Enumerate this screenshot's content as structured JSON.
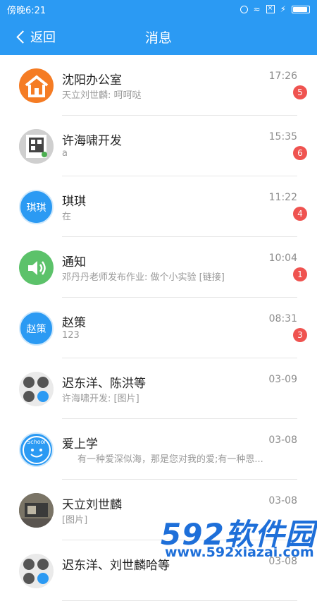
{
  "status_bar": {
    "time": "傍晚6:21"
  },
  "app_bar": {
    "back_label": "返回",
    "title": "消息"
  },
  "conversations": [
    {
      "name": "沈阳办公室",
      "preview": "天立刘世麟: 呵呵哒",
      "time": "17:26",
      "badge": "5",
      "avatar": "house-icon"
    },
    {
      "name": "许海啸开发",
      "preview": "a",
      "time": "15:35",
      "badge": "6",
      "avatar": "photo"
    },
    {
      "name": "琪琪",
      "preview": "在",
      "time": "11:22",
      "badge": "4",
      "avatar_text": "琪琪"
    },
    {
      "name": "通知",
      "preview": "邓丹丹老师发布作业: 做个小实验 [链接]",
      "time": "10:04",
      "badge": "1",
      "avatar": "speaker-icon"
    },
    {
      "name": "赵策",
      "preview": "123",
      "time": "08:31",
      "badge": "3",
      "avatar_text": "赵策"
    },
    {
      "name": "迟东洋、陈洪等",
      "preview": "许海啸开发: [图片]",
      "time": "03-09",
      "badge": null,
      "avatar": "group"
    },
    {
      "name": "爱上学",
      "preview": "有一种爱深似海，那是您对我的爱;有一种恩...",
      "time": "03-08",
      "badge": null,
      "avatar": "smiley-icon",
      "avatar_label": "School"
    },
    {
      "name": "天立刘世麟",
      "preview": "[图片]",
      "time": "03-08",
      "badge": null,
      "avatar": "photo"
    },
    {
      "name": "迟东洋、刘世麟哈等",
      "preview": "",
      "time": "03-08",
      "badge": null,
      "avatar": "group"
    }
  ],
  "watermark": {
    "big": "592软件园",
    "small": "www.592xiazai.com"
  },
  "colors": {
    "primary": "#2b9af3",
    "badge": "#ef5350",
    "house_avatar": "#f57c24",
    "notice_avatar": "#5cc26a"
  }
}
